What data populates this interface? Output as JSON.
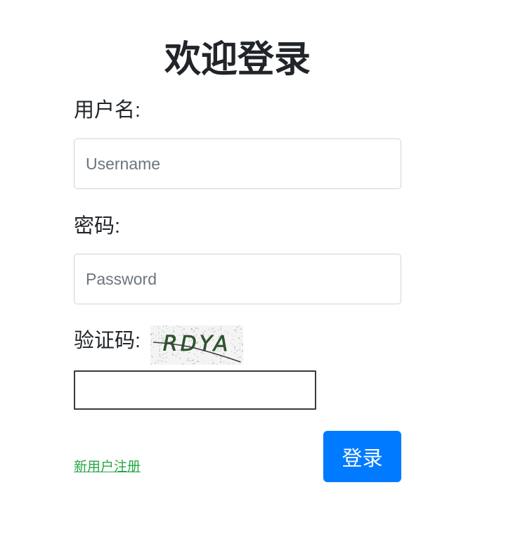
{
  "page": {
    "title": "欢迎登录"
  },
  "form": {
    "username_label": "用户名:",
    "username_placeholder": "Username",
    "password_label": "密码:",
    "password_placeholder": "Password",
    "captcha_label": "验证码:",
    "captcha_text": "RDYA",
    "captcha_value": ""
  },
  "actions": {
    "register_link": "新用户注册",
    "login_button": "登录"
  },
  "colors": {
    "primary": "#007bff",
    "link": "#28a745",
    "captcha_text": "#2e5a2e"
  }
}
